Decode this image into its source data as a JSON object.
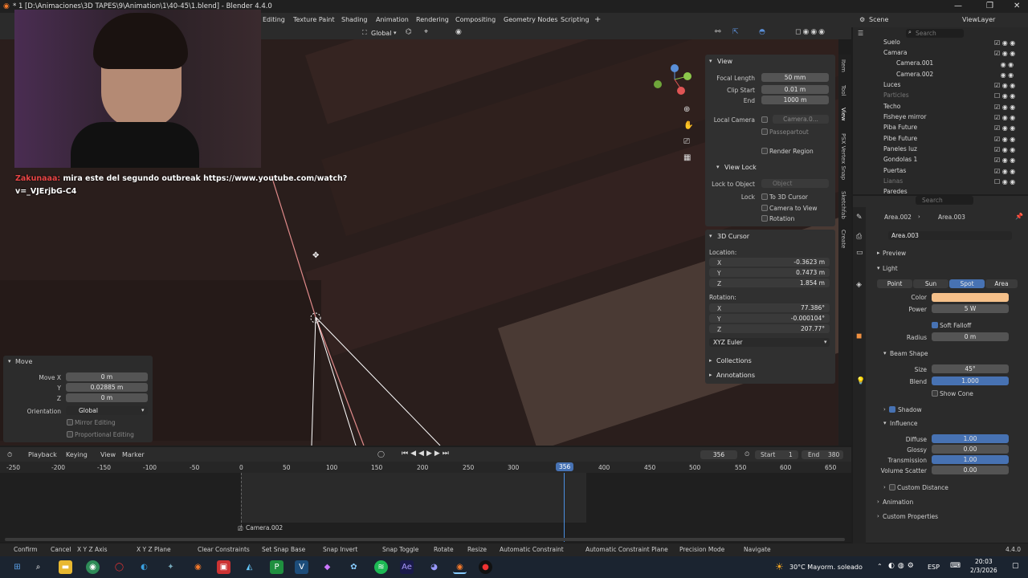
{
  "window": {
    "title": "* 1 [D:\\Animaciones\\3D TAPES\\9\\Animation\\1\\40-45\\1.blend] - Blender 4.4.0",
    "minimize": "—",
    "maximize": "❐",
    "close": "✕"
  },
  "workspaces": [
    "Editing",
    "Texture Paint",
    "Shading",
    "Animation",
    "Rendering",
    "Compositing",
    "Geometry Nodes",
    "Scripting",
    "+"
  ],
  "scene": {
    "label": "Scene",
    "view_layer": "ViewLayer"
  },
  "viewport_header": {
    "orientation": "Global"
  },
  "chat": {
    "user": "Zakunaaa:",
    "message_line1": "mira este del segundo outbreak https://www.youtube.com/watch?",
    "message_line2": "v=_VJErjbG-C4"
  },
  "npanel": {
    "view": {
      "title": "View",
      "focal_label": "Focal Length",
      "focal": "50 mm",
      "clip_start_label": "Clip Start",
      "clip_start": "0.01 m",
      "end_label": "End",
      "end": "1000 m",
      "local_camera_label": "Local Camera",
      "local_camera": "Camera.0...",
      "passepartout": "Passepartout",
      "render_region": "Render Region"
    },
    "view_lock": {
      "title": "View Lock",
      "lock_obj_label": "Lock to Object",
      "lock_obj_placeholder": "Object",
      "lock_label": "Lock",
      "to_cursor": "To 3D Cursor",
      "cam_to_view": "Camera to View",
      "rotation": "Rotation"
    },
    "cursor": {
      "title": "3D Cursor",
      "location": "Location:",
      "lx": "-0.3623 m",
      "ly": "0.7473 m",
      "lz": "1.854 m",
      "rotation": "Rotation:",
      "rx": "77.386°",
      "ry": "-0.000104°",
      "rz": "207.77°",
      "mode": "XYZ Euler",
      "x": "X",
      "y": "Y",
      "z": "Z"
    },
    "collections": "Collections",
    "annotations": "Annotations"
  },
  "ntabs": [
    "Item",
    "Tool",
    "View",
    "PSX Vertex Snap",
    "Sketchfab",
    "Create"
  ],
  "outliner": {
    "search": "Search",
    "rows": [
      "Suelo",
      "Camara",
      "Camera.001",
      "Camera.002",
      "Luces",
      "Particles",
      "Techo",
      "Fisheye mirror",
      "Piba Future",
      "Pibe Future",
      "Paneles luz",
      "Gondolas 1",
      "Puertas",
      "Lianas",
      "Paredes"
    ]
  },
  "properties": {
    "search": "Search",
    "breadcrumb1": "Area.002",
    "breadcrumb2": "Area.003",
    "datablock": "Area.003",
    "preview": "Preview",
    "light": "Light",
    "types": [
      "Point",
      "Sun",
      "Spot",
      "Area"
    ],
    "color_label": "Color",
    "color_value": "#f5c08a",
    "power_label": "Power",
    "power": "5 W",
    "soft_falloff": "Soft Falloff",
    "radius_label": "Radius",
    "radius": "0 m",
    "beam_shape": "Beam Shape",
    "size_label": "Size",
    "size": "45°",
    "blend_label": "Blend",
    "blend": "1.000",
    "show_cone": "Show Cone",
    "shadow": "Shadow",
    "influence": "Influence",
    "diffuse_label": "Diffuse",
    "diffuse": "1.00",
    "glossy_label": "Glossy",
    "glossy": "0.00",
    "transmission_label": "Transmission",
    "transmission": "1.00",
    "volume_label": "Volume Scatter",
    "volume": "0.00",
    "custom_distance": "Custom Distance",
    "animation": "Animation",
    "custom_properties": "Custom Properties"
  },
  "move_panel": {
    "title": "Move",
    "mx_label": "Move X",
    "mx": "0 m",
    "y_label": "Y",
    "my": "0.02885 m",
    "z_label": "Z",
    "mz": "0 m",
    "orient_label": "Orientation",
    "orient": "Global",
    "mirror": "Mirror Editing",
    "proportional": "Proportional Editing"
  },
  "timeline": {
    "playback": "Playback",
    "keying": "Keying",
    "view": "View",
    "marker": "Marker",
    "frame": "356",
    "start_label": "Start",
    "start": "1",
    "end_label": "End",
    "end": "380",
    "ticks": [
      "-250",
      "-200",
      "-150",
      "-100",
      "-50",
      "0",
      "50",
      "100",
      "150",
      "200",
      "250",
      "300",
      "356",
      "400",
      "450",
      "500",
      "550",
      "600",
      "650"
    ],
    "camera_marker": "Camera.002"
  },
  "status": {
    "items": [
      "Confirm",
      "Cancel",
      "X Y Z Axis",
      "X Y Z Plane",
      "Clear Constraints",
      "Set Snap Base",
      "Snap Invert",
      "Snap Toggle",
      "Rotate",
      "Resize",
      "Automatic Constraint",
      "Automatic Constraint Plane",
      "Precision Mode",
      "Navigate"
    ],
    "version": "4.4.0"
  },
  "taskbar": {
    "weather": "30°C  Mayorm. soleado",
    "lang": "ESP",
    "time": "20:03",
    "date": "2/3/2026"
  }
}
